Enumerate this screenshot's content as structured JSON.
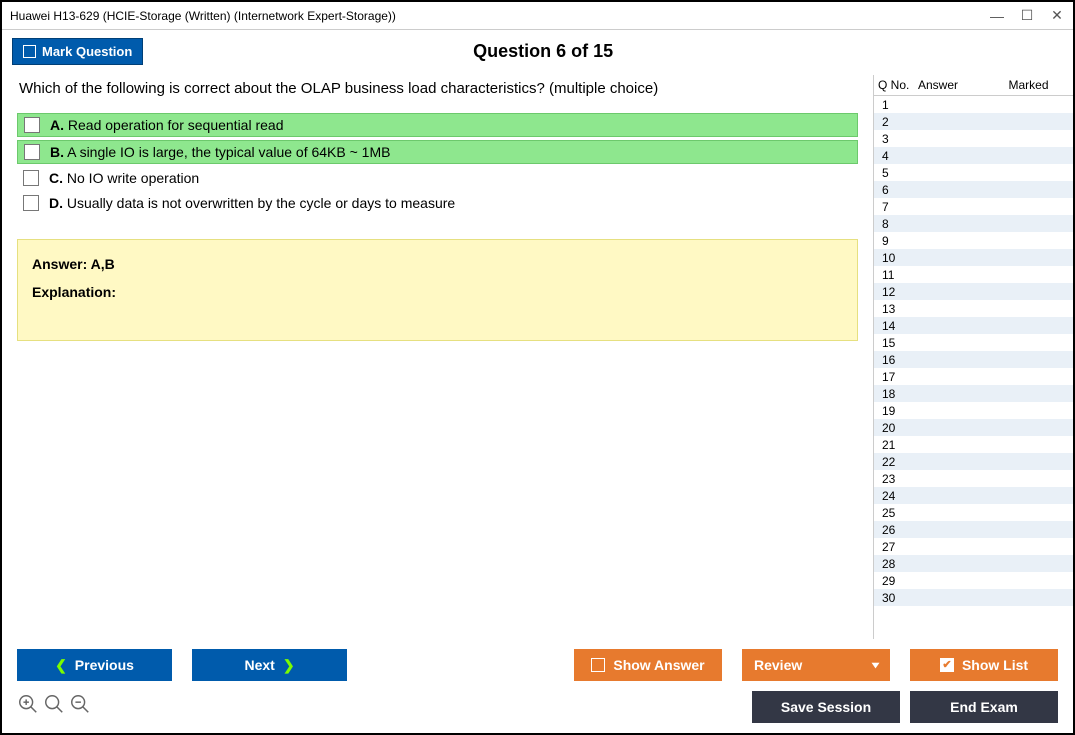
{
  "window": {
    "title": "Huawei H13-629 (HCIE-Storage (Written) (Internetwork Expert-Storage))"
  },
  "header": {
    "mark_label": "Mark Question",
    "question_title": "Question 6 of 15"
  },
  "question": {
    "text": "Which of the following is correct about the OLAP business load characteristics? (multiple choice)",
    "options": [
      {
        "letter": "A.",
        "text": "Read operation for sequential read",
        "correct": true
      },
      {
        "letter": "B.",
        "text": "A single IO is large, the typical value of 64KB ~ 1MB",
        "correct": true
      },
      {
        "letter": "C.",
        "text": "No IO write operation",
        "correct": false
      },
      {
        "letter": "D.",
        "text": "Usually data is not overwritten by the cycle or days to measure",
        "correct": false
      }
    ],
    "answer_label": "Answer: A,B",
    "explanation_label": "Explanation:"
  },
  "side": {
    "columns": {
      "q": "Q No.",
      "a": "Answer",
      "m": "Marked"
    },
    "rows": [
      1,
      2,
      3,
      4,
      5,
      6,
      7,
      8,
      9,
      10,
      11,
      12,
      13,
      14,
      15,
      16,
      17,
      18,
      19,
      20,
      21,
      22,
      23,
      24,
      25,
      26,
      27,
      28,
      29,
      30
    ]
  },
  "footer": {
    "previous": "Previous",
    "next": "Next",
    "show_answer": "Show Answer",
    "review": "Review",
    "show_list": "Show List",
    "save_session": "Save Session",
    "end_exam": "End Exam"
  }
}
